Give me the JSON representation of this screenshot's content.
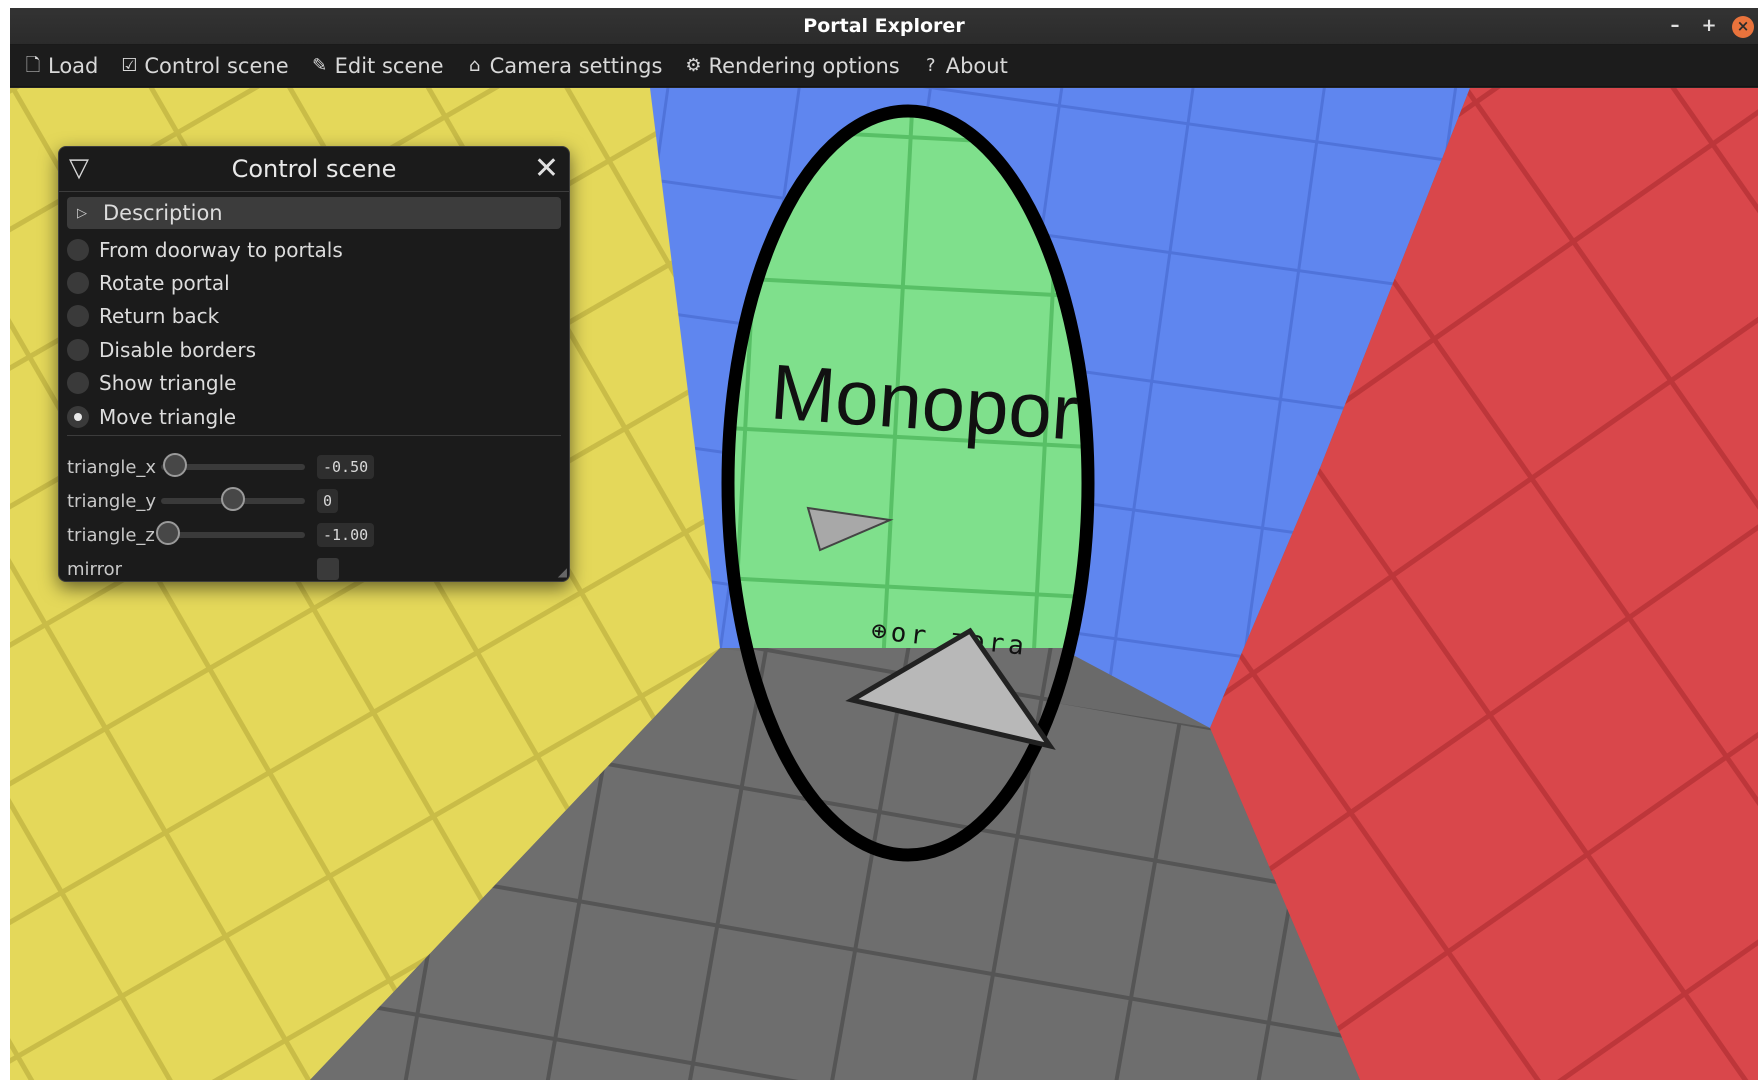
{
  "window": {
    "title": "Portal Explorer",
    "controls": {
      "minimize": "–",
      "maximize": "+",
      "close": "×"
    }
  },
  "menubar": {
    "items": [
      {
        "icon": "file-icon",
        "glyph": "🗋",
        "label": "Load"
      },
      {
        "icon": "checkbox-icon",
        "glyph": "☑",
        "label": "Control scene"
      },
      {
        "icon": "pencil-icon",
        "glyph": "✎",
        "label": "Edit scene"
      },
      {
        "icon": "camera-icon",
        "glyph": "⌂",
        "label": "Camera settings"
      },
      {
        "icon": "gear-icon",
        "glyph": "⚙",
        "label": "Rendering options"
      },
      {
        "icon": "question-icon",
        "glyph": "?",
        "label": "About"
      }
    ]
  },
  "panel": {
    "title": "Control scene",
    "collapse_glyph": "▽",
    "close_glyph": "✕",
    "description": {
      "glyph": "▷",
      "label": "Description"
    },
    "scenarios": [
      {
        "label": "From doorway to portals",
        "selected": false
      },
      {
        "label": "Rotate portal",
        "selected": false
      },
      {
        "label": "Return back",
        "selected": false
      },
      {
        "label": "Disable borders",
        "selected": false
      },
      {
        "label": "Show triangle",
        "selected": false
      },
      {
        "label": "Move triangle",
        "selected": true
      }
    ],
    "sliders": [
      {
        "label": "triangle_x",
        "value": "-0.50",
        "fraction": 0.1
      },
      {
        "label": "triangle_y",
        "value": "0",
        "fraction": 0.5
      },
      {
        "label": "triangle_z",
        "value": "-1.00",
        "fraction": 0.05
      }
    ],
    "mirror": {
      "label": "mirror",
      "checked": false
    }
  },
  "scene": {
    "portal_text": "Monopor",
    "portal_subtext": "⊕or zora",
    "colors": {
      "yellow_wall": "#e4d85a",
      "blue_wall": "#5f86ef",
      "red_wall": "#d9474b",
      "floor": "#6e6e6e",
      "portal_inside": "#7fe08c",
      "portal_frame": "#000000",
      "triangle": "#b4b4b4"
    }
  }
}
